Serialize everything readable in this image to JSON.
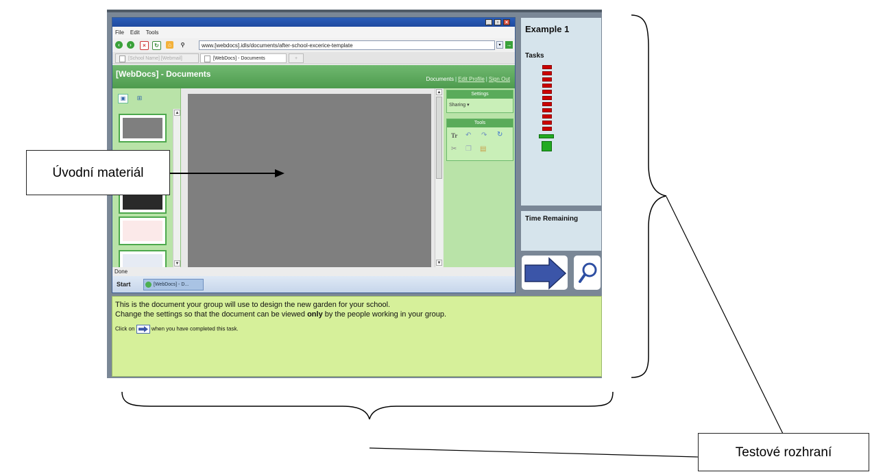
{
  "browser": {
    "menu": [
      "File",
      "Edit",
      "Tools"
    ],
    "url": "www.[webdocs].idls/documents/after-school-excerice-template",
    "tabs": [
      "[School Name] [Webmail]",
      "[WebDocs] - Documents",
      "+"
    ],
    "status": "Done",
    "taskbar": {
      "start": "Start",
      "item": "[WebDocs] - D..."
    }
  },
  "app": {
    "title": "[WebDocs] - Documents",
    "links": {
      "documents": "Documents",
      "edit_profile": "Edit Profile",
      "sign_out": "Sign Out"
    },
    "settings": {
      "header": "Settings",
      "sharing": "Sharing ▾"
    },
    "tools": {
      "header": "Tools",
      "icons": [
        "text-format-icon",
        "undo-icon",
        "redo-icon",
        "refresh-icon",
        "cut-icon",
        "copy-icon",
        "paste-icon"
      ]
    }
  },
  "side": {
    "example_title": "Example 1",
    "tasks_label": "Tasks",
    "tasks_total": 12,
    "tasks_completed": 1,
    "time_label": "Time Remaining"
  },
  "instructions": {
    "line1": "This is the document your group will use to design the new garden for your school.",
    "line2_before": "Change the settings so that the document can be viewed ",
    "line2_bold": "only",
    "line2_after": " by the people working in your group.",
    "line3_before": "Click on",
    "line3_after": "when you have completed this task."
  },
  "annotations": {
    "callout": "Úvodní materiál",
    "test_interface": "Testové rozhraní"
  },
  "colors": {
    "app_green": "#4e9b4e",
    "panel_green": "#b9e3a8",
    "instruction_bg": "#d6f09a",
    "task_pending": "#cc0000",
    "task_done": "#22aa22",
    "next_arrow": "#3b55a8"
  }
}
